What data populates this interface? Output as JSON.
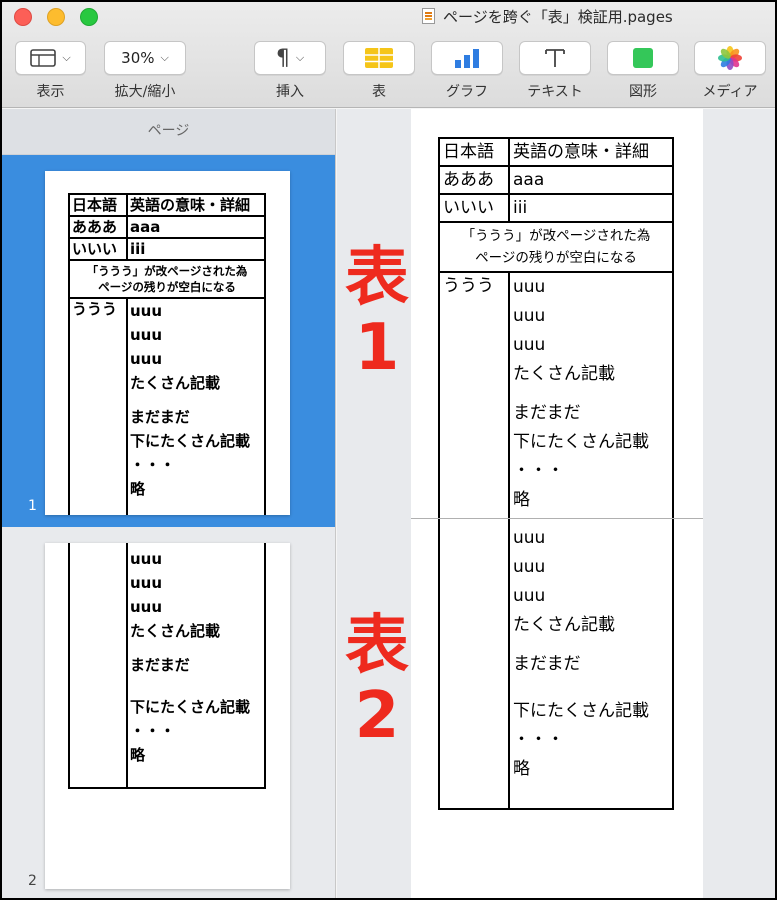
{
  "window": {
    "title": "ページを跨ぐ「表」検証用.pages",
    "traffic_lights": {
      "close": "#fc5f57",
      "minimize": "#fdbc2e",
      "zoom": "#28c840"
    }
  },
  "toolbar": {
    "view": {
      "label": "表示",
      "icon": "sidebar-view-icon"
    },
    "zoom": {
      "label": "拡大/縮小",
      "value": "30%"
    },
    "insert": {
      "label": "挿入",
      "icon": "pilcrow-icon"
    },
    "table": {
      "label": "表",
      "icon": "table-icon",
      "color": "#f5c518"
    },
    "chart": {
      "label": "グラフ",
      "icon": "chart-icon",
      "color": "#2f7de1"
    },
    "text": {
      "label": "テキスト",
      "icon": "text-box-icon"
    },
    "shape": {
      "label": "図形",
      "icon": "shape-icon",
      "color": "#34c759"
    },
    "media": {
      "label": "メディア",
      "icon": "photos-icon"
    }
  },
  "sidebar": {
    "header": "ページ",
    "pages": [
      {
        "number": "1",
        "selected": true
      },
      {
        "number": "2",
        "selected": false
      }
    ]
  },
  "annotations": {
    "table1": [
      "表",
      "1"
    ],
    "table2": [
      "表",
      "2"
    ],
    "color": "#ee2a1e"
  },
  "table": {
    "header": [
      "日本語",
      "英語の意味・詳細"
    ],
    "rows": [
      [
        "あああ",
        "aaa"
      ],
      [
        "いいい",
        "iii"
      ]
    ],
    "note_line1": "「ううう」が改ページされた為",
    "note_line2": "ページの残りが空白になる",
    "key": "ううう",
    "page1_lines": [
      "uuu",
      "uuu",
      "uuu",
      "たくさん記載",
      "まだまだ",
      "下にたくさん記載",
      "・・・",
      "略"
    ],
    "page2_lines": [
      "uuu",
      "uuu",
      "uuu",
      "たくさん記載",
      "まだまだ",
      "下にたくさん記載",
      "・・・",
      "略"
    ]
  }
}
